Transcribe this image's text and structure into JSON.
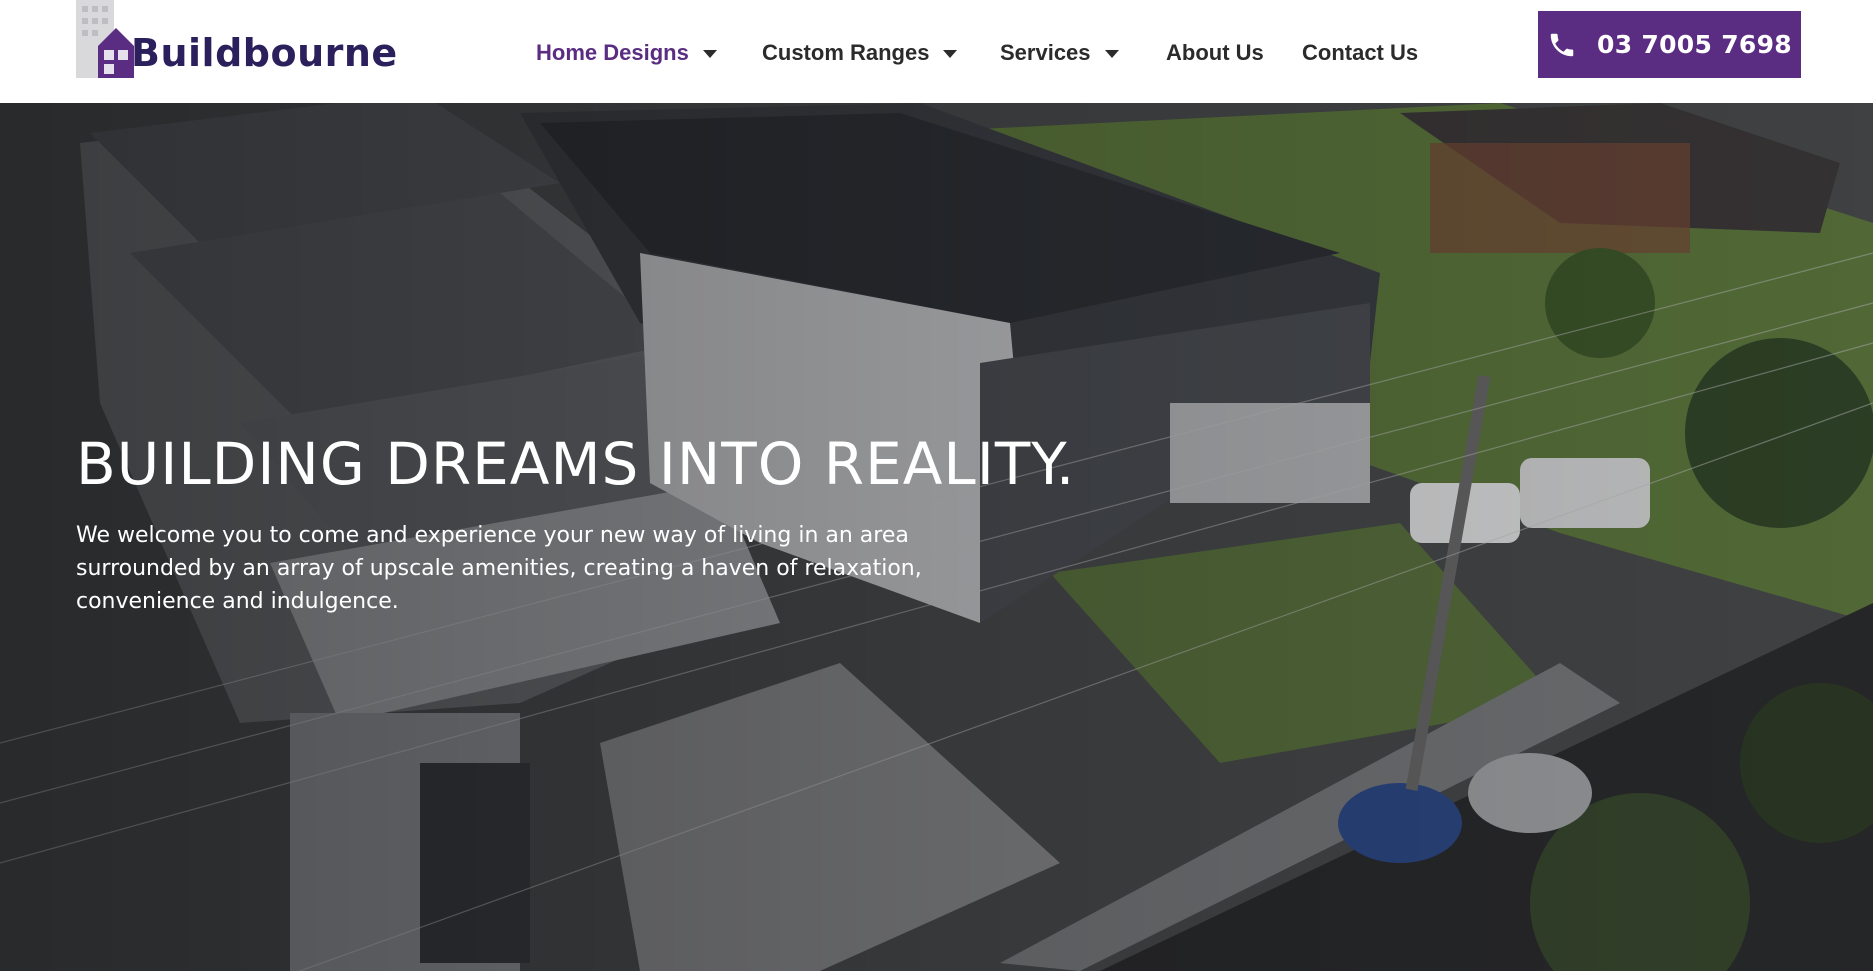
{
  "brand": {
    "name": "Buildbourne",
    "accent": "#5a2d82",
    "dark": "#2b1f5c"
  },
  "nav": {
    "items": [
      {
        "label": "Home Designs",
        "has_dropdown": true,
        "active": true
      },
      {
        "label": "Custom Ranges",
        "has_dropdown": true,
        "active": false
      },
      {
        "label": "Services",
        "has_dropdown": true,
        "active": false
      },
      {
        "label": "About Us",
        "has_dropdown": false,
        "active": false
      },
      {
        "label": "Contact Us",
        "has_dropdown": false,
        "active": false
      }
    ]
  },
  "cta": {
    "phone": "03 7005 7698",
    "icon": "phone-icon"
  },
  "hero": {
    "title": "BUILDING DREAMS INTO REALITY.",
    "text": "We welcome you to come and experience your new way of living in an area surrounded by an array of upscale amenities, creating a haven of relaxation, convenience and indulgence.",
    "image": "aerial-townhouses-photo"
  }
}
